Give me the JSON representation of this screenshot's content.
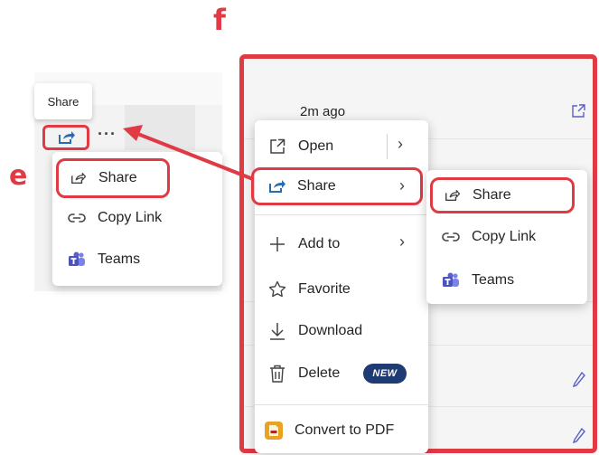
{
  "annotations": {
    "left_label": "e",
    "right_label": "f"
  },
  "left_panel": {
    "tooltip": "Share",
    "more_glyph": "···",
    "flyout_items": [
      {
        "label": "Share",
        "icon": "share-icon"
      },
      {
        "label": "Copy Link",
        "icon": "link-icon"
      },
      {
        "label": "Teams",
        "icon": "teams-icon"
      }
    ]
  },
  "right_panel": {
    "time_label": "2m ago",
    "context_menu": {
      "open": "Open",
      "share": "Share",
      "add_to": "Add to",
      "favorite": "Favorite",
      "download": "Download",
      "delete": "Delete",
      "new_badge": "NEW",
      "convert": "Convert to PDF"
    },
    "share_submenu": [
      {
        "label": "Share",
        "icon": "share-icon"
      },
      {
        "label": "Copy Link",
        "icon": "link-icon"
      },
      {
        "label": "Teams",
        "icon": "teams-icon"
      }
    ]
  },
  "colors": {
    "highlight_red": "#e03a45",
    "teams_purple": "#5b5fc7",
    "share_blue": "#2b6cb0",
    "new_badge": "#1f3b73",
    "pdf_orange": "#e8a323"
  }
}
